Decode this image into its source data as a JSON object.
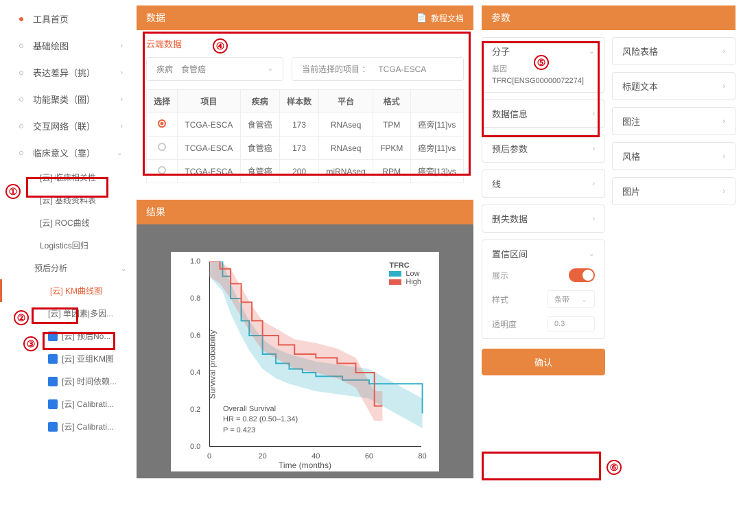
{
  "sidebar": {
    "top": [
      {
        "label": "工具首页",
        "active": true,
        "chev": false
      },
      {
        "label": "基础绘图",
        "chev": true
      },
      {
        "label": "表达差异（挑）",
        "chev": true
      },
      {
        "label": "功能聚类（圈）",
        "chev": true
      },
      {
        "label": "交互网络（联）",
        "chev": true
      },
      {
        "label": "临床意义（靠）",
        "chev": true,
        "open": true
      }
    ],
    "clinical_children": [
      {
        "label": "[云] 临床相关性"
      },
      {
        "label": "[云] 基线资料表"
      },
      {
        "label": "[云] ROC曲线"
      },
      {
        "label": "Logistics回归"
      }
    ],
    "prognosis_label": "预后分析",
    "prognosis_children": [
      {
        "label": "[云] KM曲线图",
        "active": true
      },
      {
        "label": "[云] 单因素|多因...",
        "blue": false
      },
      {
        "label": "[云] 预后No...",
        "blue": true
      },
      {
        "label": "[云] 亚组KM图",
        "blue": true
      },
      {
        "label": "[云] 时间依赖...",
        "blue": true
      },
      {
        "label": "[云] Calibrati...",
        "blue": true
      },
      {
        "label": "[云] Calibrati...",
        "blue": true
      }
    ]
  },
  "data_panel": {
    "title": "数据",
    "doc_link": "教程文档",
    "cloud_title": "云端数据",
    "disease_label": "疾病",
    "disease_value": "食管癌",
    "project_label": "当前选择的项目 ：",
    "project_value": "TCGA-ESCA",
    "columns": [
      "选择",
      "项目",
      "疾病",
      "样本数",
      "平台",
      "格式",
      ""
    ],
    "rows": [
      {
        "sel": true,
        "project": "TCGA-ESCA",
        "disease": "食管癌",
        "samples": "173",
        "platform": "RNAseq",
        "format": "TPM",
        "extra": "癌旁[11]vs"
      },
      {
        "sel": false,
        "project": "TCGA-ESCA",
        "disease": "食管癌",
        "samples": "173",
        "platform": "RNAseq",
        "format": "FPKM",
        "extra": "癌旁[11]vs"
      },
      {
        "sel": false,
        "project": "TCGA-ESCA",
        "disease": "食管癌",
        "samples": "200",
        "platform": "miRNAseq",
        "format": "RPM",
        "extra": "癌旁[13]vs"
      }
    ]
  },
  "result_panel": {
    "title": "结果"
  },
  "chart_data": {
    "type": "line",
    "title": "",
    "xlabel": "Time (months)",
    "ylabel": "Survival probability",
    "yticks": [
      0.0,
      0.2,
      0.4,
      0.6,
      0.8,
      1.0
    ],
    "xticks": [
      0,
      20,
      40,
      60,
      80
    ],
    "xlim": [
      0,
      85
    ],
    "ylim": [
      0,
      1.0
    ],
    "legend_title": "TFRC",
    "series": [
      {
        "name": "Low",
        "color": "#2fb0c9",
        "x": [
          0,
          5,
          8,
          12,
          15,
          20,
          25,
          30,
          35,
          40,
          50,
          60,
          80
        ],
        "y": [
          1.0,
          0.92,
          0.8,
          0.68,
          0.6,
          0.5,
          0.45,
          0.42,
          0.4,
          0.38,
          0.36,
          0.34,
          0.18
        ]
      },
      {
        "name": "High",
        "color": "#e35d4f",
        "x": [
          0,
          4,
          8,
          12,
          16,
          20,
          26,
          32,
          40,
          48,
          55,
          62,
          65
        ],
        "y": [
          1.0,
          0.96,
          0.88,
          0.78,
          0.68,
          0.6,
          0.55,
          0.5,
          0.48,
          0.45,
          0.4,
          0.22,
          0.22
        ]
      }
    ],
    "annotations": [
      "Overall Survival",
      "HR = 0.82 (0.50–1.34)",
      "P = 0.423"
    ]
  },
  "params": {
    "title": "参数",
    "left": [
      {
        "label": "分子",
        "open": true,
        "gene_label": "基因",
        "gene_value": "TFRC[ENSG00000072274]"
      },
      {
        "label": "数据信息"
      },
      {
        "label": "预后参数"
      },
      {
        "label": "线"
      },
      {
        "label": "删失数据"
      },
      {
        "label": "置信区间",
        "open": true,
        "fields": {
          "show_label": "展示",
          "style_label": "样式",
          "style_value": "条带",
          "opacity_label": "透明度",
          "opacity_value": "0.3"
        }
      }
    ],
    "right": [
      {
        "label": "风险表格"
      },
      {
        "label": "标题文本"
      },
      {
        "label": "图注"
      },
      {
        "label": "风格"
      },
      {
        "label": "图片"
      }
    ],
    "confirm": "确认"
  },
  "annotations": {
    "1": "①",
    "2": "②",
    "3": "③",
    "4": "④",
    "5": "⑤",
    "6": "⑥"
  }
}
